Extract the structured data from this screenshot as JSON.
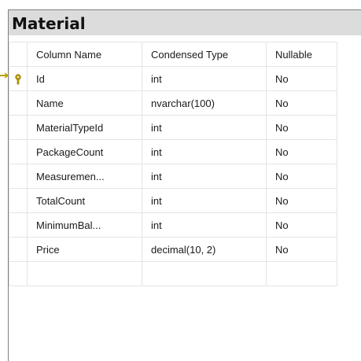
{
  "table": {
    "title": "Material",
    "headers": [
      "Column Name",
      "Condensed Type",
      "Nullable"
    ],
    "rows": [
      {
        "name": "Id",
        "type": "int",
        "nullable": "No",
        "primary_key": true
      },
      {
        "name": "Name",
        "type": "nvarchar(100)",
        "nullable": "No",
        "primary_key": false
      },
      {
        "name": "MaterialTypeId",
        "type": "int",
        "nullable": "No",
        "primary_key": false
      },
      {
        "name": "PackageCount",
        "type": "int",
        "nullable": "No",
        "primary_key": false
      },
      {
        "name": "Measuremen...",
        "type": "int",
        "nullable": "No",
        "primary_key": false
      },
      {
        "name": "TotalCount",
        "type": "int",
        "nullable": "No",
        "primary_key": false
      },
      {
        "name": "MinimumBal...",
        "type": "int",
        "nullable": "No",
        "primary_key": false
      },
      {
        "name": "Price",
        "type": "decimal(10, 2)",
        "nullable": "No",
        "primary_key": false
      },
      {
        "name": "",
        "type": "",
        "nullable": "",
        "primary_key": false
      }
    ]
  },
  "colors": {
    "title_bar": "#dcdcdc",
    "grid_line": "#e4e4e4",
    "key_icon": "#c8a800",
    "connector": "#b8a000"
  },
  "icons": {
    "key": "primary-key-icon",
    "connector": "relationship-connector-icon"
  }
}
